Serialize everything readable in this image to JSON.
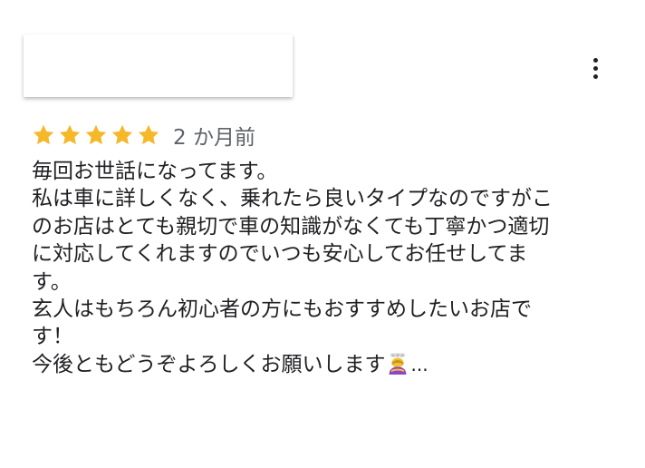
{
  "review": {
    "rating": 5,
    "max_rating": 5,
    "date": "2 か月前",
    "star_color": "#f5b829",
    "more_icon": "more-vert-icon",
    "lines": [
      "毎回お世話になってます。",
      "私は車に詳しくなく、乗れたら良いタイプなのですがこ",
      "のお店はとても親切で車の知識がなくても丁寧かつ適切",
      "に対応してくれますのでいつも安心してお任せしてま",
      "す。",
      "玄人はもちろん初心者の方にもおすすめしたいお店で",
      "す！",
      "今後ともどうぞよろしくお願いします"
    ],
    "trailing_emoji": "bowing-woman-emoji",
    "more_text": "..."
  }
}
